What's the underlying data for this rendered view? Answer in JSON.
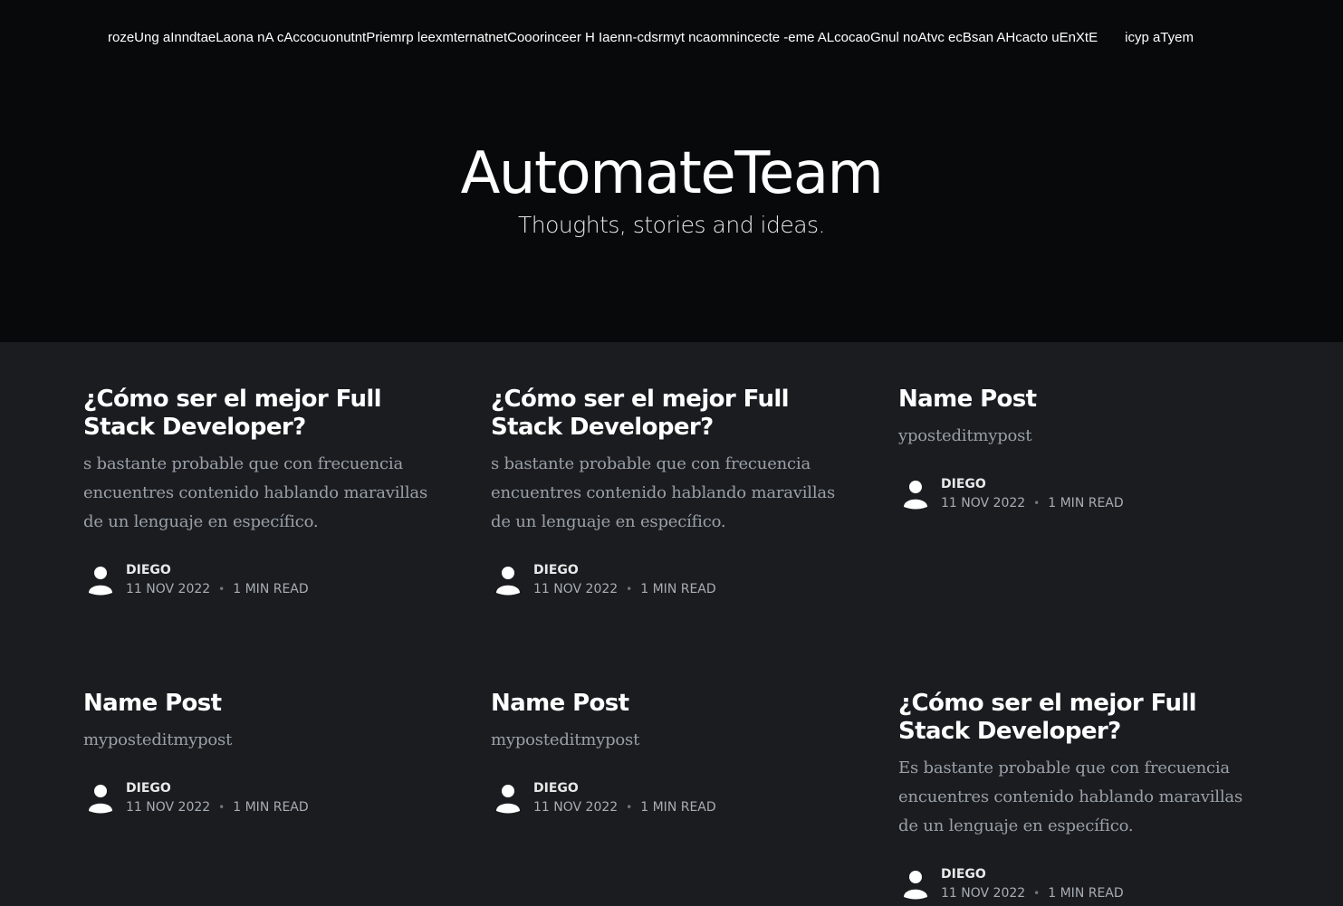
{
  "header": {
    "nav_text": "rozeUng aInndtaeLaona nA cAccocuonutntPriemrp leexmternatnetCooorinceer H Iaenn-cdsrmyt ncaomnincecte -eme ALcocaoGnul noAtvc ecBsan AHcacto uEnXtE",
    "nav_text_2": "icyp aTyem",
    "site_title": "AutomateTeam",
    "site_description": "Thoughts, stories and ideas."
  },
  "posts": [
    {
      "title": "¿Cómo ser el mejor Full Stack Developer?",
      "excerpt": "s bastante probable que con frecuencia encuentres contenido hablando maravillas de un lenguaje en específico.",
      "author": "DIEGO",
      "date": "11 NOV 2022",
      "separator": "•",
      "reading_time": "1 MIN READ"
    },
    {
      "title": "¿Cómo ser el mejor Full Stack Developer?",
      "excerpt": "s bastante probable que con frecuencia encuentres contenido hablando maravillas de un lenguaje en específico.",
      "author": "DIEGO",
      "date": "11 NOV 2022",
      "separator": "•",
      "reading_time": "1 MIN READ"
    },
    {
      "title": "Name Post",
      "excerpt": "yposteditmypost",
      "author": "DIEGO",
      "date": "11 NOV 2022",
      "separator": "•",
      "reading_time": "1 MIN READ"
    },
    {
      "title": "Name Post",
      "excerpt": "myposteditmypost",
      "author": "DIEGO",
      "date": "11 NOV 2022",
      "separator": "•",
      "reading_time": "1 MIN READ"
    },
    {
      "title": "Name Post",
      "excerpt": "myposteditmypost",
      "author": "DIEGO",
      "date": "11 NOV 2022",
      "separator": "•",
      "reading_time": "1 MIN READ"
    },
    {
      "title": "¿Cómo ser el mejor Full Stack Developer?",
      "excerpt": "Es bastante probable que con frecuencia encuentres contenido hablando maravillas de un lenguaje en específico.",
      "author": "DIEGO",
      "date": "11 NOV 2022",
      "separator": "•",
      "reading_time": "1 MIN READ"
    }
  ],
  "icons": {
    "avatar": "user-avatar-icon"
  },
  "colors": {
    "hero_background": "#08090a",
    "page_background": "#1b1c20",
    "title_text": "#ffffff",
    "excerpt_text": "#98a0a8",
    "meta_text": "#a6adb4"
  }
}
